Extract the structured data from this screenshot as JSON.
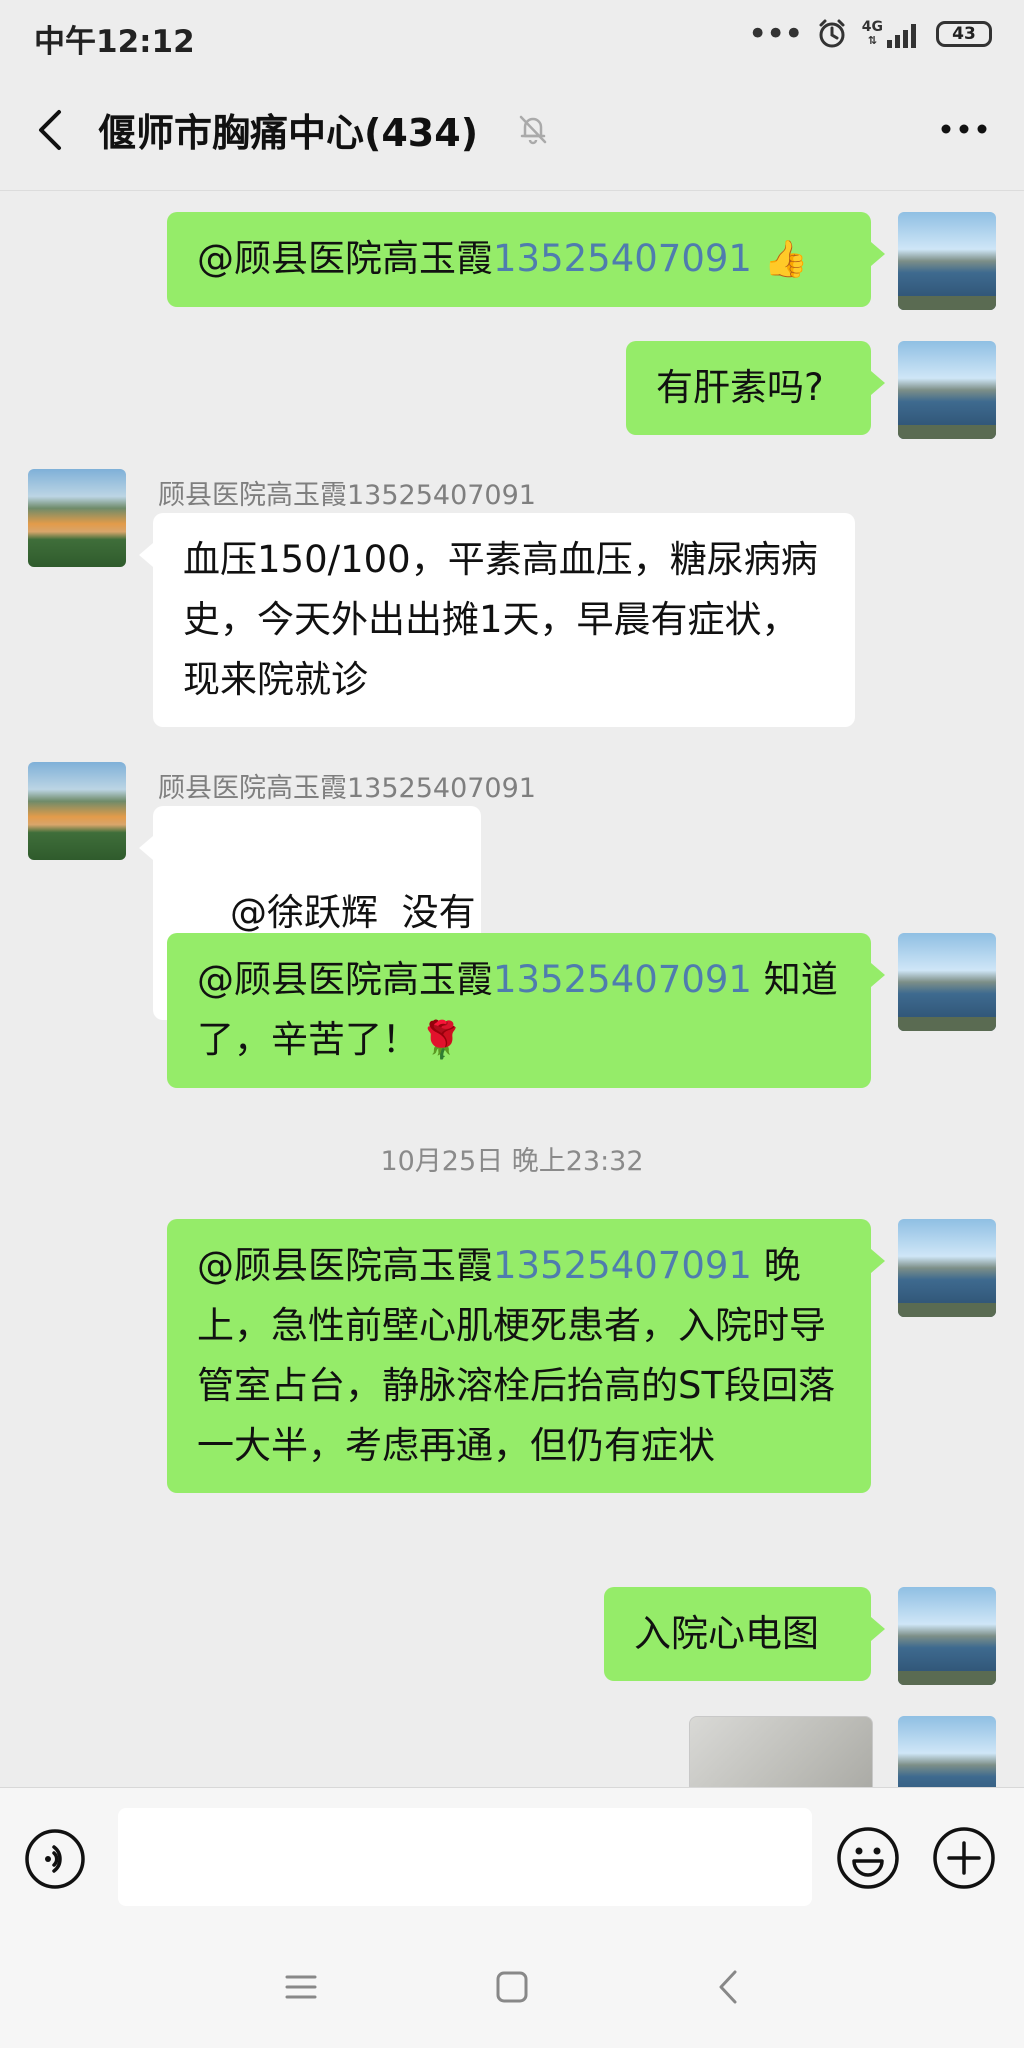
{
  "status_bar": {
    "time": "中午12:12",
    "network": "4G",
    "battery": "43"
  },
  "header": {
    "title": "偃师市胸痛中心(434)"
  },
  "messages": [
    {
      "side": "right",
      "mention": "@顾县医院高玉霞",
      "mention_number": "13525407091",
      "text": "",
      "emoji": "👍"
    },
    {
      "side": "right",
      "text": "有肝素吗?"
    },
    {
      "side": "left",
      "sender": "顾县医院高玉霞13525407091",
      "text": "血压150/100，平素高血压，糖尿病病史，今天外出出摊1天，早晨有症状，现来院就诊"
    },
    {
      "side": "left",
      "sender": "顾县医院高玉霞13525407091",
      "text": "@徐跃辉  没有"
    },
    {
      "side": "right",
      "mention": "@顾县医院高玉霞",
      "mention_number": "13525407091",
      "text": " 知道了，辛苦了！",
      "emoji": "🌹"
    },
    {
      "side": "right",
      "mention": "@顾县医院高玉霞",
      "mention_number": "13525407091",
      "text": " 晚上，急性前壁心肌梗死患者，入院时导管室占台，静脉溶栓后抬高的ST段回落一大半，考虑再通，但仍有症状"
    },
    {
      "side": "right",
      "text": "入院心电图"
    }
  ],
  "timestamp": "10月25日 晚上23:32",
  "icons": {
    "back": "back-arrow-icon",
    "mute": "bell-mute-icon",
    "more": "more-dots-icon",
    "voice": "voice-icon",
    "emoji": "emoji-icon",
    "plus": "plus-icon"
  },
  "colors": {
    "self_bubble": "#95ec69",
    "other_bubble": "#ffffff",
    "mention_number": "#4f7cae",
    "background": "#ededed"
  }
}
